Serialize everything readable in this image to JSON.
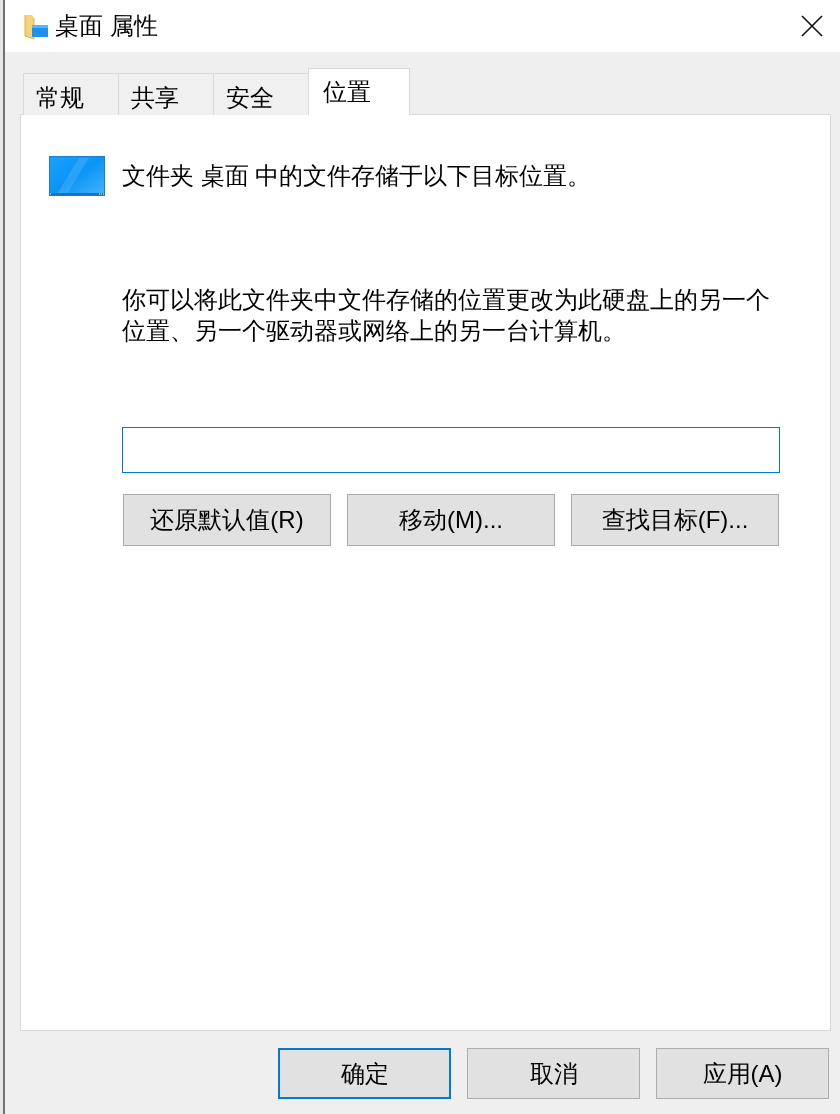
{
  "window": {
    "title": "桌面 属性"
  },
  "tabs": [
    {
      "label": "常规",
      "selected": false
    },
    {
      "label": "共享",
      "selected": false
    },
    {
      "label": "安全",
      "selected": false
    },
    {
      "label": "位置",
      "selected": true
    }
  ],
  "location_panel": {
    "description": "文件夹 桌面 中的文件存储于以下目标位置。",
    "explanation": "你可以将此文件夹中文件存储的位置更改为此硬盘上的另一个位置、另一个驱动器或网络上的另一台计算机。",
    "path_field": {
      "focused": true
    },
    "buttons": [
      {
        "label": "还原默认值(R)"
      },
      {
        "label": "移动(M)..."
      },
      {
        "label": "查找目标(F)..."
      }
    ]
  },
  "dialog_buttons": [
    {
      "label": "确定",
      "default": true
    },
    {
      "label": "取消",
      "default": false
    },
    {
      "label": "应用(A)",
      "default": false
    }
  ]
}
